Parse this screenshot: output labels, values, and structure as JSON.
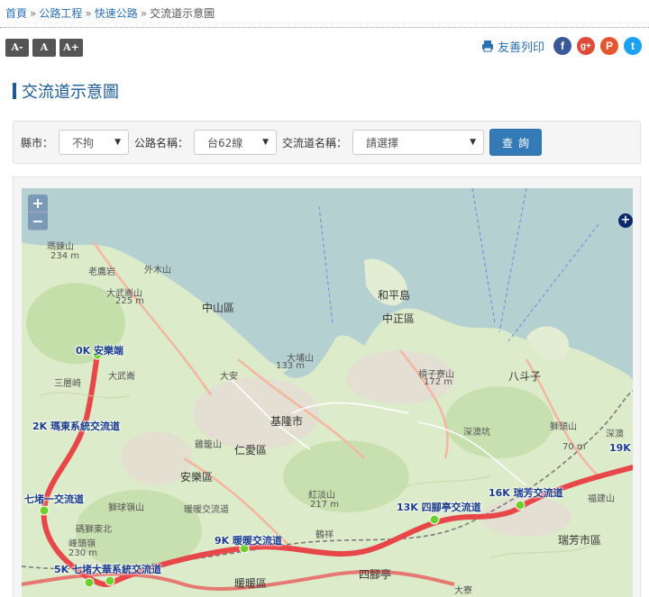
{
  "breadcrumb": {
    "items": [
      "首頁",
      "公路工程",
      "快速公路",
      "交流道示意圖"
    ],
    "separator": "»"
  },
  "font_size_buttons": [
    "A-",
    "A",
    "A+"
  ],
  "tools": {
    "print_label": "友善列印",
    "icons": [
      "facebook-icon",
      "google-plus-icon",
      "plurk-icon",
      "twitter-icon"
    ]
  },
  "page_title": "交流道示意圖",
  "search": {
    "county_label": "縣市：",
    "county_value": "不拘",
    "road_label": "公路名稱：",
    "road_value": "台62線",
    "interchange_label": "交流道名稱：",
    "interchange_value": "請選擇",
    "submit_label": "查詢"
  },
  "map": {
    "zoom_in": "+",
    "zoom_out": "−",
    "interchanges": [
      {
        "label": "0K 安樂端"
      },
      {
        "label": "2K 瑪東系統交流道"
      },
      {
        "label": "七堵一交流道"
      },
      {
        "label": "5K 七堵大華系統交流道"
      },
      {
        "label": "9K 暖暖交流道"
      },
      {
        "label": "13K 四腳亭交流道"
      },
      {
        "label": "16K 瑞芳交流道"
      },
      {
        "label": "19K"
      }
    ],
    "places": [
      {
        "name": "瑪鍊山"
      },
      {
        "name": "234 m"
      },
      {
        "name": "老鷹岩"
      },
      {
        "name": "外木山"
      },
      {
        "name": "大武崙山"
      },
      {
        "name": "225 m"
      },
      {
        "name": "中山區"
      },
      {
        "name": "和平島"
      },
      {
        "name": "中正區"
      },
      {
        "name": "仁愛區"
      },
      {
        "name": "基隆市"
      },
      {
        "name": "安樂區"
      },
      {
        "name": "暖暖區"
      },
      {
        "name": "八斗子"
      },
      {
        "name": "深澳坑"
      },
      {
        "name": "瑞芳市區"
      },
      {
        "name": "四腳亭"
      },
      {
        "name": "大寮"
      },
      {
        "name": "紅淡山"
      },
      {
        "name": "217 m"
      },
      {
        "name": "槓子寮山"
      },
      {
        "name": "172 m"
      },
      {
        "name": "大武崙"
      },
      {
        "name": "深澳"
      },
      {
        "name": "70 m"
      },
      {
        "name": "獅球嶺山"
      },
      {
        "name": "碼獅東北"
      },
      {
        "name": "230 m"
      },
      {
        "name": "三層崎"
      },
      {
        "name": "峰頭嶺"
      },
      {
        "name": "大埔山"
      },
      {
        "name": "133 m"
      },
      {
        "name": "暖暖交流道"
      },
      {
        "name": "鶴祥"
      },
      {
        "name": "雞籠山"
      },
      {
        "name": "大安"
      },
      {
        "name": "福建山"
      },
      {
        "name": "獅頭山"
      }
    ]
  },
  "colors": {
    "link": "#2a6fb4",
    "title": "#1e5a94",
    "button": "#337ab7",
    "sea": "#b5d0d0",
    "land": "#dcebc9",
    "route": "#e8474a",
    "node": "#6ed02a"
  }
}
